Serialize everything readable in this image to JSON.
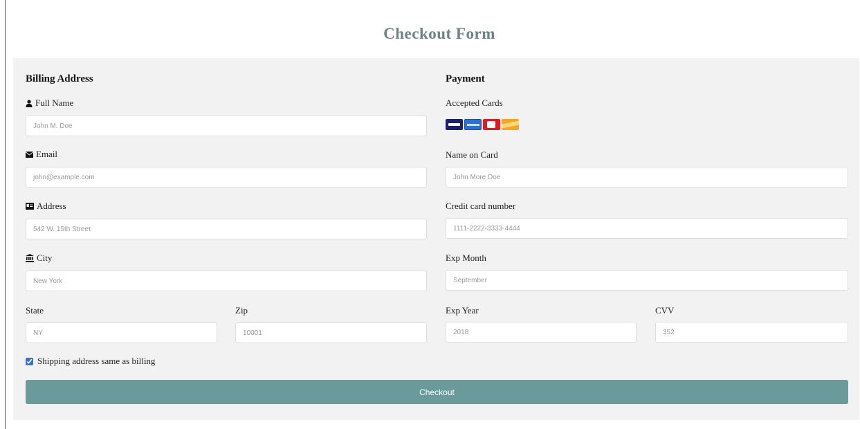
{
  "page": {
    "title": "Checkout Form"
  },
  "billing": {
    "title": "Billing Address",
    "full_name": {
      "label": "Full Name",
      "placeholder": "John M. Doe",
      "icon": "user-icon"
    },
    "email": {
      "label": "Email",
      "placeholder": "john@example.com",
      "icon": "envelope-icon"
    },
    "address": {
      "label": "Address",
      "placeholder": "542 W. 15th Street",
      "icon": "address-card-icon"
    },
    "city": {
      "label": "City",
      "placeholder": "New York",
      "icon": "institution-icon"
    },
    "state": {
      "label": "State",
      "placeholder": "NY"
    },
    "zip": {
      "label": "Zip",
      "placeholder": "10001"
    }
  },
  "payment": {
    "title": "Payment",
    "accepted_cards_label": "Accepted Cards",
    "cards": [
      "visa-card-icon",
      "amex-card-icon",
      "mastercard-card-icon",
      "discover-card-icon"
    ],
    "name_on_card": {
      "label": "Name on Card",
      "placeholder": "John More Doe"
    },
    "card_number": {
      "label": "Credit card number",
      "placeholder": "1111-2222-3333-4444"
    },
    "exp_month": {
      "label": "Exp Month",
      "placeholder": "September"
    },
    "exp_year": {
      "label": "Exp Year",
      "placeholder": "2018"
    },
    "cvv": {
      "label": "CVV",
      "placeholder": "352"
    }
  },
  "shipping_same": {
    "label": "Shipping address same as billing",
    "checked": true
  },
  "checkout_button": {
    "label": "Checkout"
  },
  "colors": {
    "accent": "#6a9a9a",
    "title": "#6e8383",
    "panel": "#f2f2f2",
    "visa": "#1a1f71",
    "amex": "#2e6fd0",
    "mastercard": "#e01b22",
    "discover": "#f5a623"
  }
}
